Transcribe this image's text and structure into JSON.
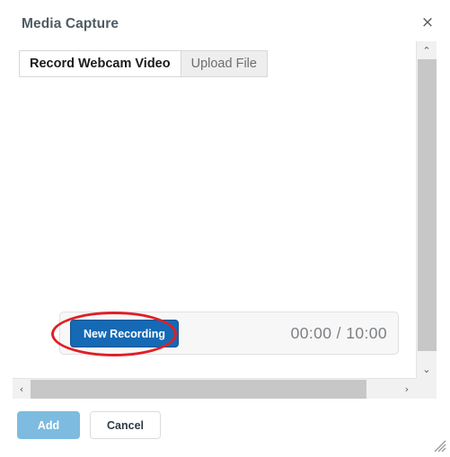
{
  "dialog": {
    "title": "Media Capture",
    "close_label": "×",
    "close_icon": "close-icon"
  },
  "tabs": [
    {
      "label": "Record Webcam Video",
      "active": true
    },
    {
      "label": "Upload File",
      "active": false
    }
  ],
  "preview": {
    "state": "empty"
  },
  "controls": {
    "new_recording_label": "New Recording",
    "timer_elapsed": "00:00",
    "timer_separator": "/",
    "timer_total": "10:00",
    "timer_display": "00:00 / 10:00"
  },
  "annotation": {
    "shape": "ellipse",
    "color": "#e01f26",
    "targets": "new-recording-button"
  },
  "footer": {
    "add_label": "Add",
    "add_disabled": true,
    "cancel_label": "Cancel"
  },
  "scrollbars": {
    "vertical": {
      "up_arrow": "⌃",
      "down_arrow": "⌄"
    },
    "horizontal": {
      "left_arrow": "‹",
      "right_arrow": "›"
    }
  },
  "colors": {
    "primary_button": "#1569b5",
    "disabled_button": "#7dbbe0",
    "annotation_red": "#e01f26",
    "title_text": "#4e5b63",
    "timer_text": "#7b8085",
    "panel_bg": "#f7f7f7",
    "scrollbar_thumb": "#c7c7c7"
  }
}
